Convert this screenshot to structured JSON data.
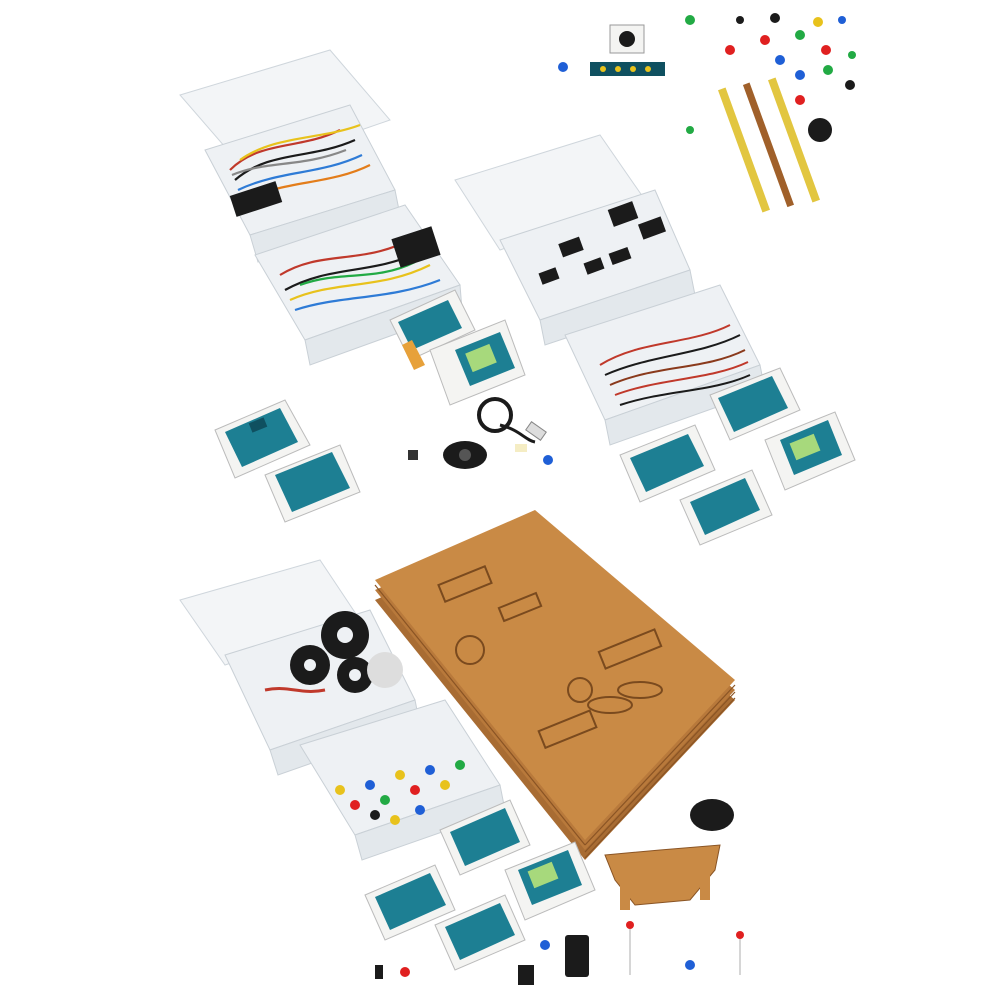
{
  "image": {
    "background": "#ffffff",
    "colors": {
      "box_plastic": "#eef1f4",
      "box_edge": "#c9d0d6",
      "board_teal": "#1d7f93",
      "board_dark": "#0f5060",
      "card_white": "#f4f4f2",
      "card_accent": "#e7a13a",
      "wood": "#c98a45",
      "wood_dark": "#8a5424",
      "wire_red": "#c0392b",
      "wire_black": "#1b1b1b",
      "wire_yellow": "#e8c21c",
      "led_red": "#e02020",
      "led_green": "#22aa44",
      "led_blue": "#1f5fd6",
      "led_yellow": "#f0d000"
    },
    "components": [
      "storage-box",
      "jumper-wires",
      "arduino-board",
      "lcd-shield",
      "servo-motor",
      "wheel",
      "laser-cut-wood-panels",
      "led",
      "resistor",
      "pin-header",
      "buzzer",
      "usb-cable"
    ]
  }
}
